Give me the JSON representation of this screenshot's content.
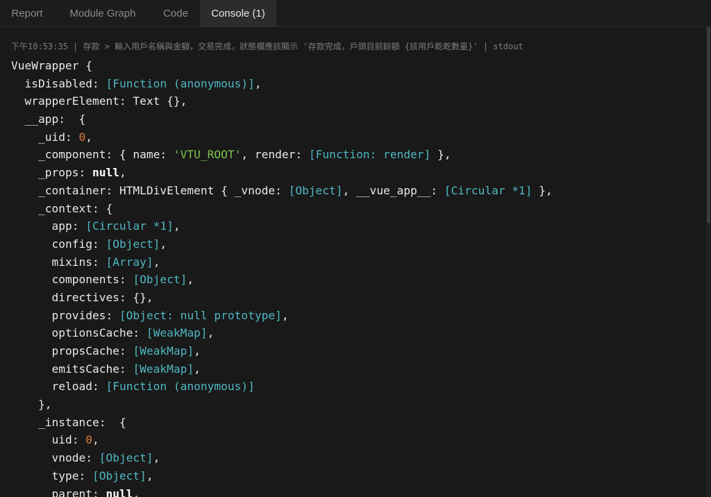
{
  "tabs": [
    {
      "label": "Report",
      "active": false
    },
    {
      "label": "Module Graph",
      "active": false
    },
    {
      "label": "Code",
      "active": false
    },
    {
      "label": "Console (1)",
      "active": true
    }
  ],
  "console": {
    "meta_line": "下午10:53:35 | 存款 > 輸入用戶名稱與金額，交易完成，狀態欄應該顯示 '存款完成，戶頭目前餘額 {該用戶乾乾數量}' | stdout",
    "lines": [
      [
        {
          "t": "VueWrapper {",
          "k": "plain"
        }
      ],
      [
        {
          "t": "  isDisabled: ",
          "k": "plain"
        },
        {
          "t": "[Function (anonymous)]",
          "k": "special"
        },
        {
          "t": ",",
          "k": "plain"
        }
      ],
      [
        {
          "t": "  wrapperElement: Text {},",
          "k": "plain"
        }
      ],
      [
        {
          "t": "  __app:  {",
          "k": "plain"
        }
      ],
      [
        {
          "t": "    _uid: ",
          "k": "plain"
        },
        {
          "t": "0",
          "k": "number"
        },
        {
          "t": ",",
          "k": "plain"
        }
      ],
      [
        {
          "t": "    _component: { name: ",
          "k": "plain"
        },
        {
          "t": "'VTU_ROOT'",
          "k": "string"
        },
        {
          "t": ", render: ",
          "k": "plain"
        },
        {
          "t": "[Function: render]",
          "k": "special"
        },
        {
          "t": " },",
          "k": "plain"
        }
      ],
      [
        {
          "t": "    _props: ",
          "k": "plain"
        },
        {
          "t": "null",
          "k": "bold"
        },
        {
          "t": ",",
          "k": "plain"
        }
      ],
      [
        {
          "t": "    _container: HTMLDivElement { _vnode: ",
          "k": "plain"
        },
        {
          "t": "[Object]",
          "k": "special"
        },
        {
          "t": ", __vue_app__: ",
          "k": "plain"
        },
        {
          "t": "[Circular *1]",
          "k": "special"
        },
        {
          "t": " },",
          "k": "plain"
        }
      ],
      [
        {
          "t": "    _context: {",
          "k": "plain"
        }
      ],
      [
        {
          "t": "      app: ",
          "k": "plain"
        },
        {
          "t": "[Circular *1]",
          "k": "special"
        },
        {
          "t": ",",
          "k": "plain"
        }
      ],
      [
        {
          "t": "      config: ",
          "k": "plain"
        },
        {
          "t": "[Object]",
          "k": "special"
        },
        {
          "t": ",",
          "k": "plain"
        }
      ],
      [
        {
          "t": "      mixins: ",
          "k": "plain"
        },
        {
          "t": "[Array]",
          "k": "special"
        },
        {
          "t": ",",
          "k": "plain"
        }
      ],
      [
        {
          "t": "      components: ",
          "k": "plain"
        },
        {
          "t": "[Object]",
          "k": "special"
        },
        {
          "t": ",",
          "k": "plain"
        }
      ],
      [
        {
          "t": "      directives: {},",
          "k": "plain"
        }
      ],
      [
        {
          "t": "      provides: ",
          "k": "plain"
        },
        {
          "t": "[Object: null prototype]",
          "k": "special"
        },
        {
          "t": ",",
          "k": "plain"
        }
      ],
      [
        {
          "t": "      optionsCache: ",
          "k": "plain"
        },
        {
          "t": "[WeakMap]",
          "k": "special"
        },
        {
          "t": ",",
          "k": "plain"
        }
      ],
      [
        {
          "t": "      propsCache: ",
          "k": "plain"
        },
        {
          "t": "[WeakMap]",
          "k": "special"
        },
        {
          "t": ",",
          "k": "plain"
        }
      ],
      [
        {
          "t": "      emitsCache: ",
          "k": "plain"
        },
        {
          "t": "[WeakMap]",
          "k": "special"
        },
        {
          "t": ",",
          "k": "plain"
        }
      ],
      [
        {
          "t": "      reload: ",
          "k": "plain"
        },
        {
          "t": "[Function (anonymous)]",
          "k": "special"
        }
      ],
      [
        {
          "t": "    },",
          "k": "plain"
        }
      ],
      [
        {
          "t": "    _instance:  {",
          "k": "plain"
        }
      ],
      [
        {
          "t": "      uid: ",
          "k": "plain"
        },
        {
          "t": "0",
          "k": "number"
        },
        {
          "t": ",",
          "k": "plain"
        }
      ],
      [
        {
          "t": "      vnode: ",
          "k": "plain"
        },
        {
          "t": "[Object]",
          "k": "special"
        },
        {
          "t": ",",
          "k": "plain"
        }
      ],
      [
        {
          "t": "      type: ",
          "k": "plain"
        },
        {
          "t": "[Object]",
          "k": "special"
        },
        {
          "t": ",",
          "k": "plain"
        }
      ],
      [
        {
          "t": "      parent: ",
          "k": "plain"
        },
        {
          "t": "null",
          "k": "bold"
        },
        {
          "t": ",",
          "k": "plain"
        }
      ]
    ]
  },
  "colors": {
    "background": "#191919",
    "tab_active_bg": "#2c2c2c",
    "plain_text": "#e9e9e9",
    "special_value": "#4fb8c4",
    "number_value": "#e07b3a",
    "string_value": "#7fc34b",
    "meta_text": "#7d7d7d"
  }
}
